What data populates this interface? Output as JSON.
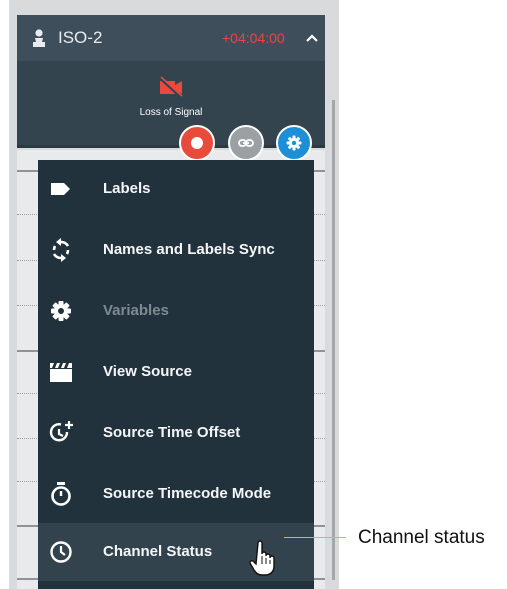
{
  "channel": {
    "name": "ISO-2",
    "timecode": "+04:04:00",
    "status_text": "Loss of Signal"
  },
  "menu": {
    "items": [
      {
        "label": "Labels",
        "icon": "label-tag-icon",
        "enabled": true
      },
      {
        "label": "Names and Labels Sync",
        "icon": "sync-icon",
        "enabled": true
      },
      {
        "label": "Variables",
        "icon": "gear-icon",
        "enabled": false
      },
      {
        "label": "View Source",
        "icon": "clapperboard-icon",
        "enabled": true
      },
      {
        "label": "Source Time Offset",
        "icon": "time-offset-icon",
        "enabled": true
      },
      {
        "label": "Source Timecode Mode",
        "icon": "stopwatch-icon",
        "enabled": true
      },
      {
        "label": "Channel Status",
        "icon": "clock-icon",
        "enabled": true,
        "highlighted": true
      }
    ]
  },
  "callout": {
    "label": "Channel status"
  },
  "colors": {
    "record": "#e84b3c",
    "timecode": "#e8473b",
    "settings": "#1e8fd6",
    "menu_bg": "#22323c",
    "callout_line": "#e8a27a"
  }
}
